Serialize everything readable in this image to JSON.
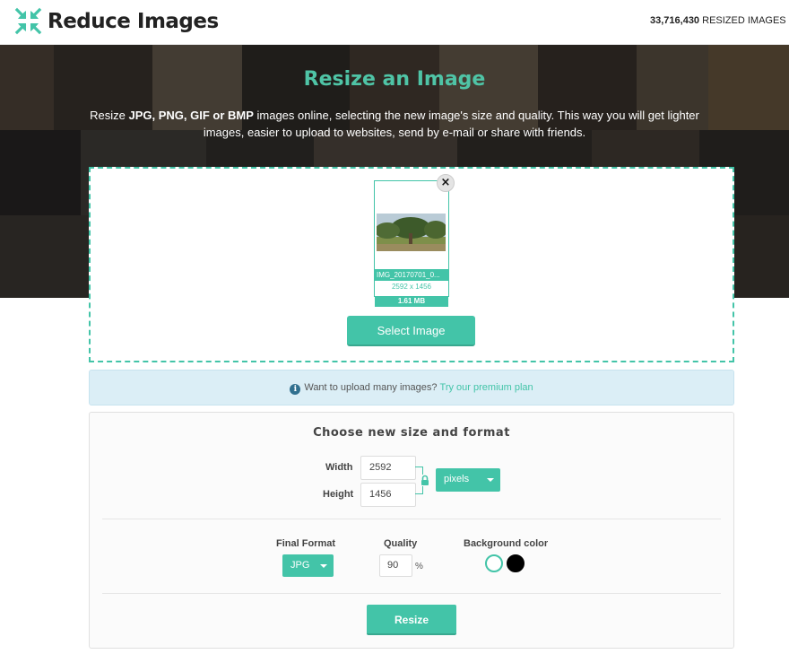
{
  "header": {
    "logo_text": "Reduce Images",
    "counter_value": "33,716,430",
    "counter_label": "RESIZED IMAGES SO"
  },
  "hero": {
    "title": "Resize an Image",
    "desc_pre": "Resize ",
    "desc_formats": "JPG, PNG, GIF or BMP",
    "desc_post": " images online, selecting the new image's size and quality. This way you will get lighter images, easier to upload to websites, send by e-mail or share with friends."
  },
  "upload": {
    "file_name": "IMG_20170701_0...",
    "dimensions": "2592 x 1456",
    "file_size": "1.61 MB",
    "remove_symbol": "×",
    "select_label": "Select Image"
  },
  "info": {
    "icon": "i",
    "text": "Want to upload many images?",
    "link": "Try our premium plan"
  },
  "settings": {
    "title": "Choose new size and format",
    "width_label": "Width",
    "width_value": "2592",
    "height_label": "Height",
    "height_value": "1456",
    "unit_selected": "pixels",
    "format_label": "Final Format",
    "format_selected": "JPG",
    "quality_label": "Quality",
    "quality_value": "90",
    "quality_unit": "%",
    "bg_label": "Background color",
    "bg_colors": [
      "#ffffff",
      "#000000"
    ],
    "resize_label": "Resize"
  },
  "colors": {
    "accent": "#43c4a8",
    "info_bg": "#dbeef6",
    "hero_title": "#4fc4a6"
  }
}
